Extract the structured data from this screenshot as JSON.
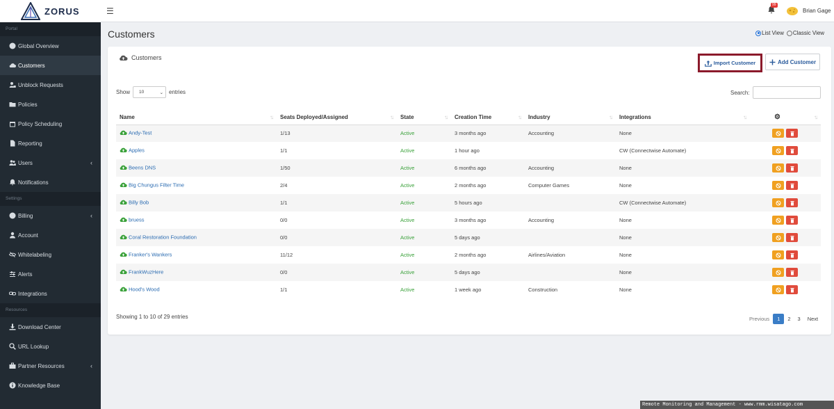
{
  "brand": {
    "name": "ZORUS"
  },
  "header": {
    "notification_count": "99",
    "user_name": "Brian Gage"
  },
  "sidebar": {
    "sections": [
      {
        "label": "Portal",
        "items": [
          {
            "label": "Global Overview",
            "icon": "globe-icon"
          },
          {
            "label": "Customers",
            "icon": "cloud-icon",
            "active": true
          },
          {
            "label": "Unblock Requests",
            "icon": "user-lock-icon"
          },
          {
            "label": "Policies",
            "icon": "folder-icon"
          },
          {
            "label": "Policy Scheduling",
            "icon": "calendar-icon"
          },
          {
            "label": "Reporting",
            "icon": "file-icon"
          },
          {
            "label": "Users",
            "icon": "users-icon",
            "expandable": true
          },
          {
            "label": "Notifications",
            "icon": "bell-icon"
          }
        ]
      },
      {
        "label": "Settings",
        "items": [
          {
            "label": "Billing",
            "icon": "globe-icon",
            "expandable": true
          },
          {
            "label": "Account",
            "icon": "user-icon"
          },
          {
            "label": "Whitelabeling",
            "icon": "eye-slash-icon"
          },
          {
            "label": "Alerts",
            "icon": "sliders-icon"
          },
          {
            "label": "Integrations",
            "icon": "link-icon"
          }
        ]
      },
      {
        "label": "Resources",
        "items": [
          {
            "label": "Download Center",
            "icon": "download-icon"
          },
          {
            "label": "URL Lookup",
            "icon": "search-icon"
          },
          {
            "label": "Partner Resources",
            "icon": "briefcase-icon",
            "expandable": true
          },
          {
            "label": "Knowledge Base",
            "icon": "info-icon"
          }
        ]
      }
    ]
  },
  "page": {
    "title": "Customers",
    "view_list": "List View",
    "view_classic": "Classic View",
    "view_selected": "List View"
  },
  "card": {
    "title": "Customers",
    "import_label": "Import Customer",
    "add_label": "Add Customer",
    "show_label": "Show",
    "entries_value": "10",
    "entries_label": "entries",
    "search_label": "Search:",
    "search_value": ""
  },
  "table": {
    "columns": [
      "Name",
      "Seats Deployed/Assigned",
      "State",
      "Creation Time",
      "Industry",
      "Integrations",
      ""
    ],
    "rows": [
      {
        "name": "Andy-Test",
        "seats": "1/13",
        "state": "Active",
        "created": "3 months ago",
        "industry": "Accounting",
        "integrations": "None"
      },
      {
        "name": "Apples",
        "seats": "1/1",
        "state": "Active",
        "created": "1 hour ago",
        "industry": "",
        "integrations": "CW (Connectwise Automate)"
      },
      {
        "name": "Beens DNS",
        "seats": "1/50",
        "state": "Active",
        "created": "6 months ago",
        "industry": "Accounting",
        "integrations": "None"
      },
      {
        "name": "Big Chungus Filter Time",
        "seats": "2/4",
        "state": "Active",
        "created": "2 months ago",
        "industry": "Computer Games",
        "integrations": "None"
      },
      {
        "name": "Billy Bob",
        "seats": "1/1",
        "state": "Active",
        "created": "5 hours ago",
        "industry": "",
        "integrations": "CW (Connectwise Automate)"
      },
      {
        "name": "bruess",
        "seats": "0/0",
        "state": "Active",
        "created": "3 months ago",
        "industry": "Accounting",
        "integrations": "None"
      },
      {
        "name": "Coral Restoration Foundation",
        "seats": "0/0",
        "state": "Active",
        "created": "5 days ago",
        "industry": "",
        "integrations": "None"
      },
      {
        "name": "Franker's Wankers",
        "seats": "11/12",
        "state": "Active",
        "created": "2 months ago",
        "industry": "Airlines/Aviation",
        "integrations": "None"
      },
      {
        "name": "FrankWuzHere",
        "seats": "0/0",
        "state": "Active",
        "created": "5 days ago",
        "industry": "",
        "integrations": "None"
      },
      {
        "name": "Hood's Wood",
        "seats": "1/1",
        "state": "Active",
        "created": "1 week ago",
        "industry": "Construction",
        "integrations": "None"
      }
    ]
  },
  "footer": {
    "info": "Showing 1 to 10 of 29 entries",
    "previous": "Previous",
    "pages": [
      "1",
      "2",
      "3"
    ],
    "current_page": "1",
    "next": "Next"
  },
  "watermark": "Remote Monitoring and Management - www.rmm.wisatago.com",
  "colors": {
    "sidebar": "#222b33",
    "link": "#2a6bb1",
    "active_state": "#3aa13a",
    "disable_button": "#f0a020",
    "delete_button": "#e04b3c",
    "import_highlight": "#8b1a2b"
  }
}
